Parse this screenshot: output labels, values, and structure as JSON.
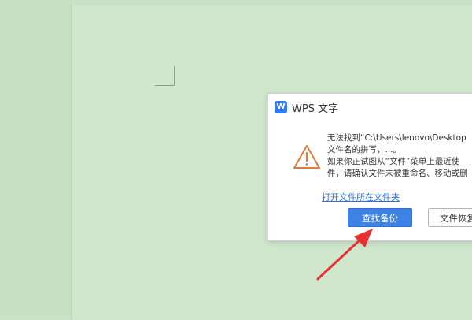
{
  "dialog": {
    "app_icon_glyph": "W",
    "title": "WPS 文字",
    "message": {
      "line1": "无法找到“C:\\Users\\lenovo\\Desktop",
      "line2": "文件名的拼写，...。",
      "line3": "如果你正试图从“文件”菜单上最近使",
      "line4": "件，请确认文件未被重命名、移动或删"
    },
    "open_folder_link": "打开文件所在文件夹",
    "find_backup_button": "查找备份",
    "file_recovery_button": "文件恢复"
  },
  "colors": {
    "document_background": "#d0e7cd",
    "accent": "#3d83e6",
    "warning": "#e07b39",
    "annotation_arrow": "#e8312f"
  },
  "icons": {
    "app": "wps-writer-icon",
    "warning": "warning-triangle-icon",
    "annotation": "red-arrow-icon"
  }
}
